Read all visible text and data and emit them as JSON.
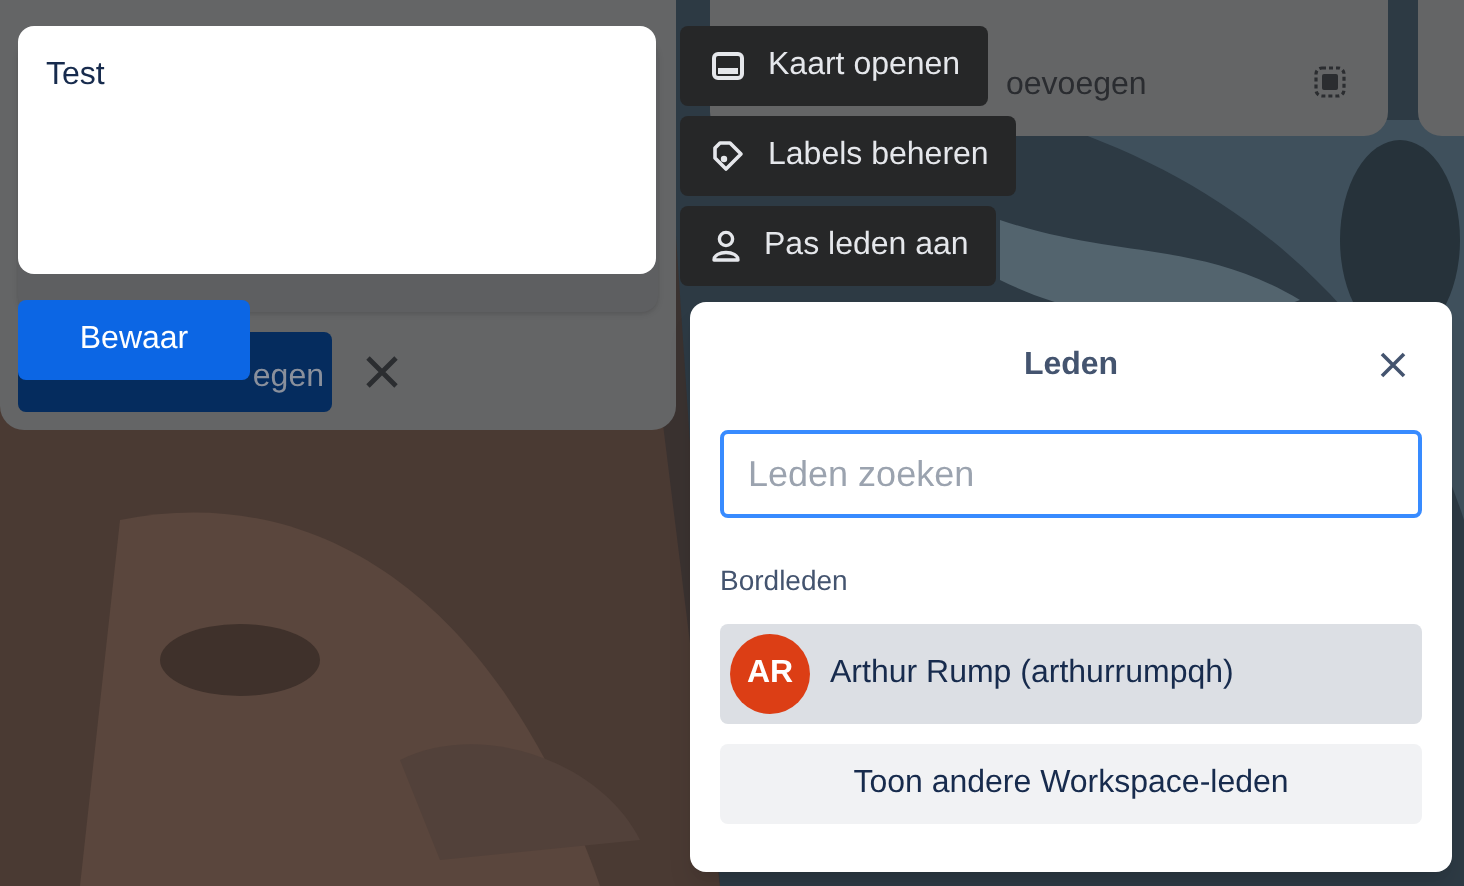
{
  "list_behind": {
    "add_button": "egen"
  },
  "list_next": {
    "add_card": "oevoegen"
  },
  "card_editor": {
    "value": "Test",
    "save_button": "Bewaar"
  },
  "quick_actions": [
    {
      "kind": "card",
      "label": "Kaart openen"
    },
    {
      "kind": "label",
      "label": "Labels beheren"
    },
    {
      "kind": "member",
      "label": "Pas leden aan"
    }
  ],
  "popup": {
    "title": "Leden",
    "search": {
      "placeholder": "Leden zoeken",
      "focused": true
    },
    "section": "Bordleden",
    "members": [
      {
        "initials": "AR",
        "name": "Arthur Rump (arthurrumpqh)",
        "color": "#dc3e15"
      }
    ],
    "show_more": "Toon andere Workspace-leden"
  }
}
